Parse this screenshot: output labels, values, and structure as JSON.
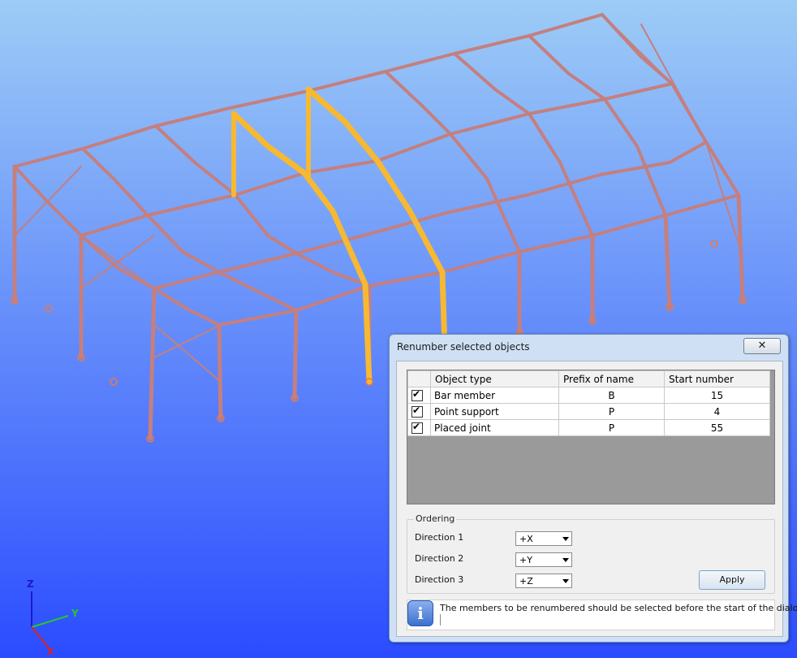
{
  "window": {
    "title": "Renumber selected objects",
    "close_glyph": "✕"
  },
  "table": {
    "headers": [
      "",
      "Object type",
      "Prefix of name",
      "Start number"
    ],
    "rows": [
      {
        "checked": true,
        "object_type": "Bar member",
        "prefix": "B",
        "start": "15"
      },
      {
        "checked": true,
        "object_type": "Point support",
        "prefix": "P",
        "start": "4"
      },
      {
        "checked": true,
        "object_type": "Placed joint",
        "prefix": "P",
        "start": "55"
      }
    ]
  },
  "ordering": {
    "legend": "Ordering",
    "direction1_label": "Direction 1",
    "direction1_value": "+X",
    "direction2_label": "Direction 2",
    "direction2_value": "+Y",
    "direction3_label": "Direction 3",
    "direction3_value": "+Z",
    "apply_label": "Apply"
  },
  "info": {
    "icon": "info-icon",
    "message": "The members to be renumbered should be selected before the start of the dialogue!",
    "glyph": "i"
  },
  "axes": {
    "z": "Z",
    "y": "Y",
    "x": "X"
  },
  "colors": {
    "background_top": "#9dccf6",
    "background_bottom": "#2b4cff",
    "member": "#c47f7f",
    "selected_member": "#f7b832",
    "support": "#e87a4a",
    "axis_z": "#1a1acc",
    "axis_y": "#22cc22",
    "axis_x": "#dd2222"
  }
}
